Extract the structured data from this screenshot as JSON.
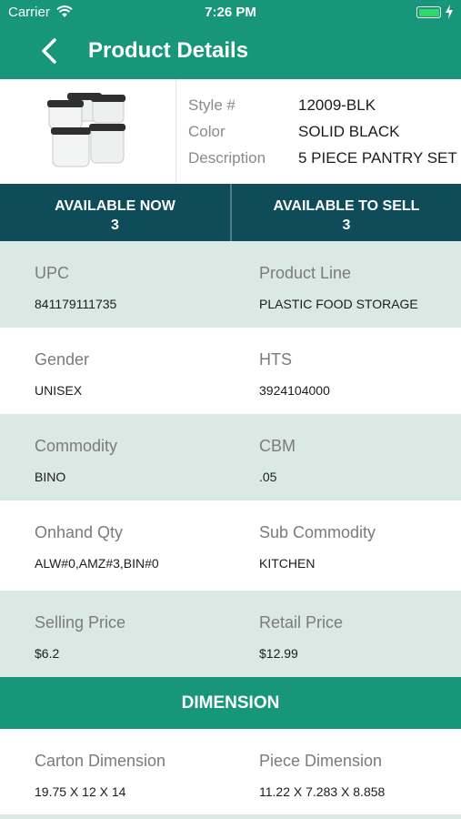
{
  "status_bar": {
    "carrier": "Carrier",
    "time": "7:26 PM"
  },
  "header": {
    "title": "Product Details",
    "back_icon": "chevron-left-icon"
  },
  "product": {
    "image": "food-storage-containers-image",
    "specs": [
      {
        "label": "Style #",
        "value": "12009-BLK"
      },
      {
        "label": "Color",
        "value": "SOLID BLACK"
      },
      {
        "label": "Description",
        "value": "5 PIECE PANTRY SET"
      }
    ]
  },
  "availability": {
    "now_label": "AVAILABLE NOW",
    "now_value": "3",
    "sell_label": "AVAILABLE TO SELL",
    "sell_value": "3"
  },
  "details": [
    {
      "left_label": "UPC",
      "left_value": "841179111735",
      "right_label": "Product Line",
      "right_value": "PLASTIC FOOD STORAGE"
    },
    {
      "left_label": "Gender",
      "left_value": "UNISEX",
      "right_label": "HTS",
      "right_value": "3924104000"
    },
    {
      "left_label": "Commodity",
      "left_value": "BINO",
      "right_label": "CBM",
      "right_value": ".05"
    },
    {
      "left_label": "Onhand Qty",
      "left_value": "ALW#0,AMZ#3,BIN#0",
      "right_label": "Sub Commodity",
      "right_value": "KITCHEN"
    },
    {
      "left_label": "Selling Price",
      "left_value": "$6.2",
      "right_label": "Retail Price",
      "right_value": "$12.99"
    }
  ],
  "dimension_section": {
    "title": "DIMENSION",
    "left_label": "Carton Dimension",
    "left_value": "19.75 X 12 X 14",
    "right_label": "Piece Dimension",
    "right_value": "11.22 X 7.283 X 8.858"
  },
  "colors": {
    "header": "#17967a",
    "availability": "#0f4c5a",
    "shaded_row": "#dbe9e4"
  }
}
